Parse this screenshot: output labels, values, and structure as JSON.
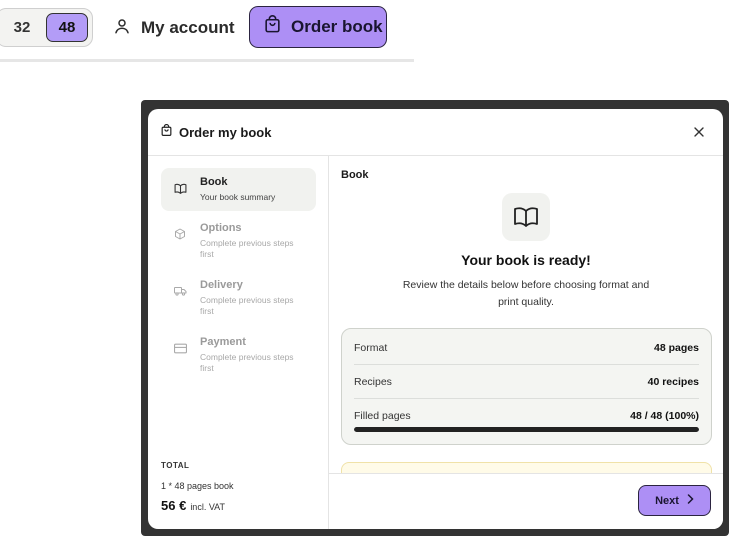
{
  "topbar": {
    "page_counts": [
      "32",
      "48"
    ],
    "selected_count": "48",
    "account_label": "My account",
    "order_button_label": "Order book",
    "icons": {
      "account": "user-icon",
      "order": "shopping-bag-icon"
    }
  },
  "modal": {
    "title": "Order my book",
    "icons": {
      "title": "shopping-bag-icon",
      "close": "close-icon"
    },
    "steps": [
      {
        "title": "Book",
        "subtitle": "Your book summary",
        "icon": "book-open-icon",
        "state": "active"
      },
      {
        "title": "Options",
        "subtitle": "Complete previous steps first",
        "icon": "box-icon",
        "state": "locked"
      },
      {
        "title": "Delivery",
        "subtitle": "Complete previous steps first",
        "icon": "truck-icon",
        "state": "locked"
      },
      {
        "title": "Payment",
        "subtitle": "Complete previous steps first",
        "icon": "credit-card-icon",
        "state": "locked"
      }
    ],
    "total": {
      "label": "TOTAL",
      "line": "1 * 48 pages book",
      "price": "56 €",
      "vat": "incl. VAT"
    },
    "main": {
      "section_title": "Book",
      "heading": "Your book is ready!",
      "description": "Review the details below before choosing format and print quality.",
      "rows": [
        {
          "label": "Format",
          "value": "48 pages"
        },
        {
          "label": "Recipes",
          "value": "40 recipes"
        },
        {
          "label": "Filled pages",
          "value": "48 / 48 (100%)"
        }
      ],
      "filled_fraction": 1.0
    },
    "next_label": "Next"
  },
  "colors": {
    "accent": "#ad8ff5",
    "selected": "#b39cf7",
    "panel": "#f1f2ef",
    "overlay": "#333333"
  }
}
